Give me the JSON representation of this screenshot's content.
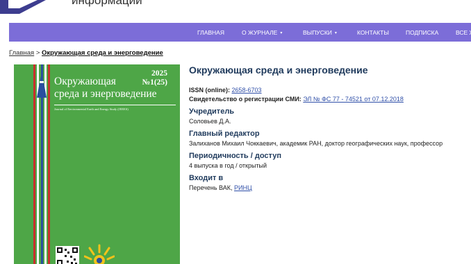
{
  "site": {
    "name": "информаций"
  },
  "nav": {
    "items": [
      {
        "label": "ГЛАВНАЯ",
        "dropdown": false
      },
      {
        "label": "О ЖУРНАЛЕ",
        "dropdown": true
      },
      {
        "label": "ВЫПУСКИ",
        "dropdown": true
      },
      {
        "label": "КОНТАКТЫ",
        "dropdown": false
      },
      {
        "label": "ПОДПИСКА",
        "dropdown": false
      },
      {
        "label": "ВСЕ Ж",
        "dropdown": false
      }
    ],
    "caret": "▾"
  },
  "breadcrumb": {
    "home": "Главная",
    "separator": ">",
    "current": "Окружающая среда и энерговедение"
  },
  "cover": {
    "title_line1": "Окружающая",
    "title_line2": "среда и энерговедение",
    "year": "2025",
    "issue": "№1(25)",
    "subtitle": "Journal of Environmental Earth and Energy Study (JEEES)",
    "colors": {
      "background": "#4ea647"
    }
  },
  "journal": {
    "title": "Окружающая среда и энерговедение",
    "issn_label": "ISSN (online):",
    "issn_value": "2658-6703",
    "smi_label": "Свидетельство о регистрации СМИ:",
    "smi_value": "ЭЛ № ФС 77 - 74521 от 07.12.2018",
    "founder_heading": "Учредитель",
    "founder_value": "Соловьев Д.А.",
    "editor_heading": "Главный редактор",
    "editor_value": "Залиханов Михаил Чоккаевич, академик РАН, доктор географических наук, профессор",
    "period_heading": "Периодичность / доступ",
    "period_value": "4 выпуска в год  / открытый",
    "indexing_heading": "Входит в",
    "indexing_prefix": "Перечень ВАК, ",
    "indexing_link": "РИНЦ"
  },
  "colors": {
    "nav_bg": "#7c6dd8",
    "heading": "#1f3a5c",
    "link": "#2f4fa8"
  }
}
